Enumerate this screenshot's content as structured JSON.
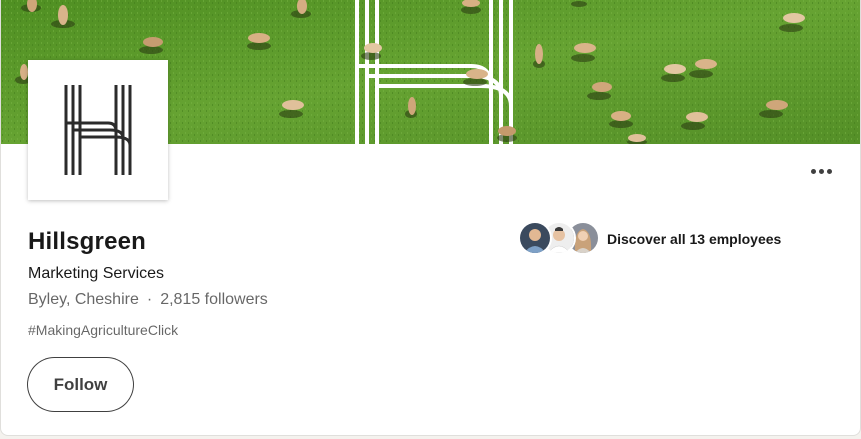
{
  "company": {
    "name": "Hillsgreen",
    "industry": "Marketing Services",
    "location": "Byley, Cheshire",
    "separator": "·",
    "followers": "2,815 followers",
    "hashtag": "#MakingAgricultureClick"
  },
  "actions": {
    "follow_label": "Follow",
    "more_icon": "ellipsis-icon"
  },
  "employees": {
    "link_label": "Discover all 13 employees",
    "avatar_count": 3
  },
  "banner": {
    "description_icon": "cows-in-field-banner",
    "grass_color": "#5e9a2b",
    "logo_stroke_color": "#ffffff"
  },
  "colors": {
    "logo_stroke": "#2b2b2b",
    "card_bg": "#ffffff",
    "page_bg": "#f4f2ee"
  }
}
